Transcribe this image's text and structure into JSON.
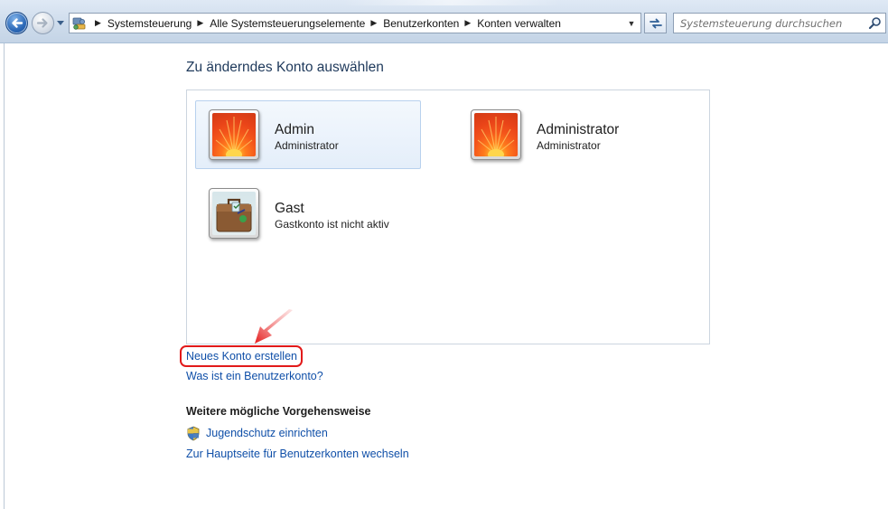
{
  "navigation": {
    "back_icon": "back-arrow-icon",
    "forward_icon": "forward-arrow-icon",
    "recent_icon": "chevron-down-icon"
  },
  "address": {
    "icon": "control-panel-icon",
    "breadcrumbs": [
      "Systemsteuerung",
      "Alle Systemsteuerungselemente",
      "Benutzerkonten",
      "Konten verwalten"
    ]
  },
  "search": {
    "placeholder": "Systemsteuerung durchsuchen"
  },
  "page": {
    "title": "Zu änderndes Konto auswählen"
  },
  "accounts": [
    {
      "name": "Admin",
      "role": "Administrator",
      "picture": "flower-avatar",
      "selected": true
    },
    {
      "name": "Administrator",
      "role": "Administrator",
      "picture": "flower-avatar",
      "selected": false
    },
    {
      "name": "Gast",
      "role": "Gastkonto ist nicht aktiv",
      "picture": "suitcase-avatar",
      "selected": false
    }
  ],
  "links": {
    "create_account": "Neues Konto erstellen",
    "what_is_account": "Was ist ein Benutzerkonto?"
  },
  "more_actions": {
    "heading": "Weitere mögliche Vorgehensweise",
    "parental_controls": "Jugendschutz einrichten",
    "main_page": "Zur Hauptseite für Benutzerkonten wechseln"
  },
  "colors": {
    "link": "#0f4fa8",
    "title": "#1e395b",
    "highlight": "#e21a1a"
  }
}
